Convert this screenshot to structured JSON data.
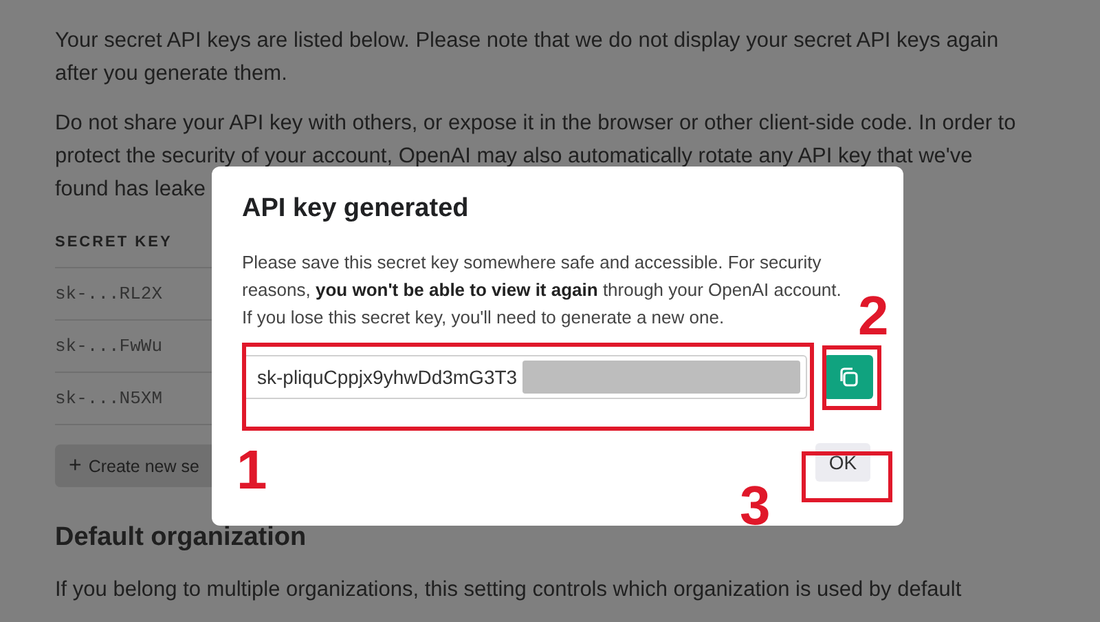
{
  "page": {
    "intro_lines": [
      "Your secret API keys are listed below. Please note that we do not display your secret API keys again",
      "after you generate them."
    ],
    "warning_lines": [
      "Do not share your API key with others, or expose it in the browser or other client-side code. In order to",
      "protect the security of your account, OpenAI may also automatically rotate any API key that we've",
      "found has leake"
    ],
    "table": {
      "columns": [
        "SECRET KEY"
      ],
      "rows": [
        "sk-...RL2X",
        "sk-...FwWu",
        "sk-...N5XM"
      ]
    },
    "create_button": {
      "icon": "+",
      "label": "Create new se"
    },
    "section_title": "Default organization",
    "section_text": "If you belong to multiple organizations, this setting controls which organization is used by default"
  },
  "dialog": {
    "title": "API key generated",
    "message": "Please save this secret key somewhere safe and accessible. For security reasons, **you won't be able to view it again** through your OpenAI account. If you lose this secret key, you'll need to generate a new one.",
    "key_value": "sk-pliquCppjx9yhwDd3mG3T3",
    "ok_button": "OK"
  },
  "annotations": [
    {
      "label": "1"
    },
    {
      "label": "2"
    },
    {
      "label": "3"
    }
  ]
}
